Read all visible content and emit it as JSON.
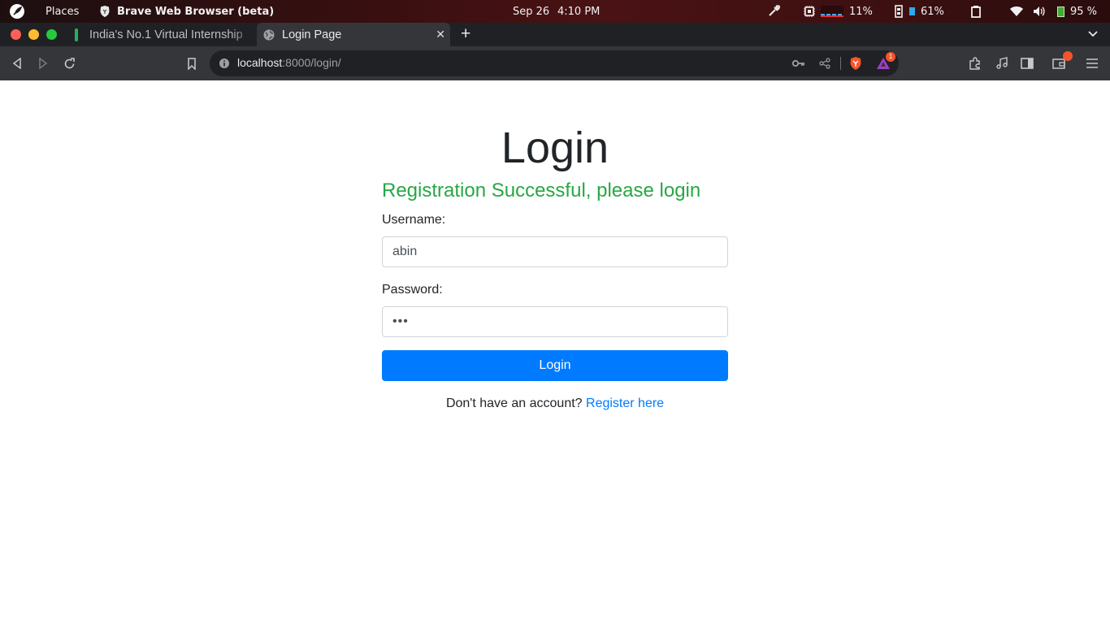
{
  "system_bar": {
    "places": "Places",
    "app_name": "Brave Web Browser (beta)",
    "date": "Sep 26",
    "time": "4:10 PM",
    "cpu_percent": "11%",
    "memory_percent": "61%",
    "battery_percent": "95 %"
  },
  "tabs": [
    {
      "title": "India's No.1 Virtual Internship",
      "active": false
    },
    {
      "title": "Login Page",
      "active": true
    }
  ],
  "toolbar": {
    "url_host": "localhost",
    "url_rest": ":8000/login/",
    "rewards_badge": "1"
  },
  "page": {
    "title": "Login",
    "flash_message": "Registration Successful, please login",
    "username_label": "Username:",
    "username_value": "abin",
    "password_label": "Password:",
    "password_value": "•••",
    "login_button": "Login",
    "register_prompt": "Don't have an account?",
    "register_link": "Register here"
  },
  "colors": {
    "accent": "#007bff",
    "success": "#28a745",
    "topbar": "#3a0f10",
    "toolbar": "#35363a"
  }
}
